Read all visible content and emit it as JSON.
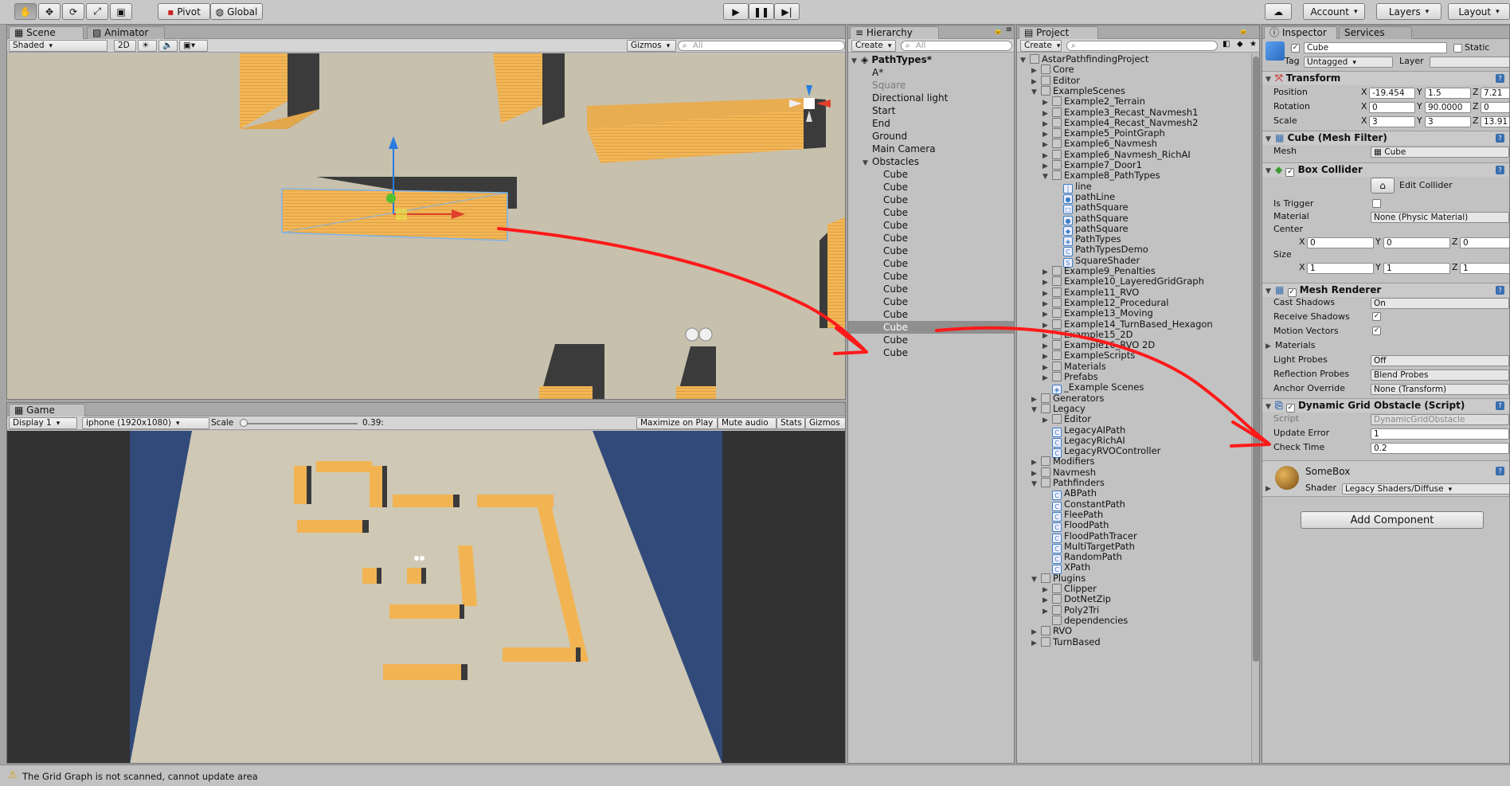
{
  "toolbar": {
    "tools": [
      "hand-icon",
      "move-icon",
      "rotate-icon",
      "scale-icon",
      "rect-icon"
    ],
    "pivot": "Pivot",
    "global": "Global",
    "account": "Account",
    "layers": "Layers",
    "layout": "Layout"
  },
  "scene": {
    "tab": "Scene",
    "tab2": "Animator",
    "shading": "Shaded",
    "mode2d": "2D",
    "gizmos": "Gizmos",
    "search": "All"
  },
  "game": {
    "tab": "Game",
    "display": "Display 1",
    "resolution": "iphone (1920x1080)",
    "scale_label": "Scale",
    "scale_value": "0.39:",
    "scale_fraction": 0.0,
    "maximize": "Maximize on Play",
    "mute": "Mute audio",
    "stats": "Stats",
    "gizmos": "Gizmos"
  },
  "hierarchy": {
    "tab": "Hierarchy",
    "create": "Create",
    "search": "All",
    "root": "PathTypes*",
    "items": [
      {
        "label": "A*",
        "depth": 1,
        "arrow": false
      },
      {
        "label": "Square",
        "depth": 1,
        "arrow": false,
        "dim": true
      },
      {
        "label": "Directional light",
        "depth": 1,
        "arrow": false
      },
      {
        "label": "Start",
        "depth": 1,
        "arrow": false
      },
      {
        "label": "End",
        "depth": 1,
        "arrow": false
      },
      {
        "label": "Ground",
        "depth": 1,
        "arrow": false
      },
      {
        "label": "Main Camera",
        "depth": 1,
        "arrow": false
      },
      {
        "label": "Obstacles",
        "depth": 1,
        "arrow": true
      },
      {
        "label": "Cube",
        "depth": 2
      },
      {
        "label": "Cube",
        "depth": 2
      },
      {
        "label": "Cube",
        "depth": 2
      },
      {
        "label": "Cube",
        "depth": 2
      },
      {
        "label": "Cube",
        "depth": 2
      },
      {
        "label": "Cube",
        "depth": 2
      },
      {
        "label": "Cube",
        "depth": 2
      },
      {
        "label": "Cube",
        "depth": 2
      },
      {
        "label": "Cube",
        "depth": 2
      },
      {
        "label": "Cube",
        "depth": 2
      },
      {
        "label": "Cube",
        "depth": 2
      },
      {
        "label": "Cube",
        "depth": 2
      },
      {
        "label": "Cube",
        "depth": 2,
        "selected": true
      },
      {
        "label": "Cube",
        "depth": 2
      },
      {
        "label": "Cube",
        "depth": 2
      }
    ]
  },
  "project": {
    "tab": "Project",
    "create": "Create",
    "items": [
      {
        "label": "AstarPathfindingProject",
        "depth": 0,
        "arrow": "open",
        "icon": "folder"
      },
      {
        "label": "Core",
        "depth": 1,
        "arrow": "closed",
        "icon": "folder"
      },
      {
        "label": "Editor",
        "depth": 1,
        "arrow": "closed",
        "icon": "folder"
      },
      {
        "label": "ExampleScenes",
        "depth": 1,
        "arrow": "open",
        "icon": "folder"
      },
      {
        "label": "Example2_Terrain",
        "depth": 2,
        "arrow": "closed",
        "icon": "folder"
      },
      {
        "label": "Example3_Recast_Navmesh1",
        "depth": 2,
        "arrow": "closed",
        "icon": "folder"
      },
      {
        "label": "Example4_Recast_Navmesh2",
        "depth": 2,
        "arrow": "closed",
        "icon": "folder"
      },
      {
        "label": "Example5_PointGraph",
        "depth": 2,
        "arrow": "closed",
        "icon": "folder"
      },
      {
        "label": "Example6_Navmesh",
        "depth": 2,
        "arrow": "closed",
        "icon": "folder"
      },
      {
        "label": "Example6_Navmesh_RichAI",
        "depth": 2,
        "arrow": "closed",
        "icon": "folder"
      },
      {
        "label": "Example7_Door1",
        "depth": 2,
        "arrow": "closed",
        "icon": "folder"
      },
      {
        "label": "Example8_PathTypes",
        "depth": 2,
        "arrow": "open",
        "icon": "folder"
      },
      {
        "label": "line",
        "depth": 3,
        "icon": "line"
      },
      {
        "label": "pathLine",
        "depth": 3,
        "icon": "material"
      },
      {
        "label": "pathSquare",
        "depth": 3,
        "icon": "texture"
      },
      {
        "label": "pathSquare",
        "depth": 3,
        "icon": "material"
      },
      {
        "label": "pathSquare",
        "depth": 3,
        "icon": "prefab"
      },
      {
        "label": "PathTypes",
        "depth": 3,
        "icon": "unity"
      },
      {
        "label": "PathTypesDemo",
        "depth": 3,
        "icon": "script"
      },
      {
        "label": "SquareShader",
        "depth": 3,
        "icon": "shader"
      },
      {
        "label": "Example9_Penalties",
        "depth": 2,
        "arrow": "closed",
        "icon": "folder"
      },
      {
        "label": "Example10_LayeredGridGraph",
        "depth": 2,
        "arrow": "closed",
        "icon": "folder"
      },
      {
        "label": "Example11_RVO",
        "depth": 2,
        "arrow": "closed",
        "icon": "folder"
      },
      {
        "label": "Example12_Procedural",
        "depth": 2,
        "arrow": "closed",
        "icon": "folder"
      },
      {
        "label": "Example13_Moving",
        "depth": 2,
        "arrow": "closed",
        "icon": "folder"
      },
      {
        "label": "Example14_TurnBased_Hexagon",
        "depth": 2,
        "arrow": "closed",
        "icon": "folder"
      },
      {
        "label": "Example15_2D",
        "depth": 2,
        "arrow": "closed",
        "icon": "folder"
      },
      {
        "label": "Example16_RVO 2D",
        "depth": 2,
        "arrow": "closed",
        "icon": "folder"
      },
      {
        "label": "ExampleScripts",
        "depth": 2,
        "arrow": "closed",
        "icon": "folder"
      },
      {
        "label": "Materials",
        "depth": 2,
        "arrow": "closed",
        "icon": "folder"
      },
      {
        "label": "Prefabs",
        "depth": 2,
        "arrow": "closed",
        "icon": "folder"
      },
      {
        "label": "_Example Scenes",
        "depth": 2,
        "icon": "unity"
      },
      {
        "label": "Generators",
        "depth": 1,
        "arrow": "closed",
        "icon": "folder"
      },
      {
        "label": "Legacy",
        "depth": 1,
        "arrow": "open",
        "icon": "folder"
      },
      {
        "label": "Editor",
        "depth": 2,
        "arrow": "closed",
        "icon": "folder"
      },
      {
        "label": "LegacyAIPath",
        "depth": 2,
        "icon": "script"
      },
      {
        "label": "LegacyRichAI",
        "depth": 2,
        "icon": "script"
      },
      {
        "label": "LegacyRVOController",
        "depth": 2,
        "icon": "script"
      },
      {
        "label": "Modifiers",
        "depth": 1,
        "arrow": "closed",
        "icon": "folder"
      },
      {
        "label": "Navmesh",
        "depth": 1,
        "arrow": "closed",
        "icon": "folder"
      },
      {
        "label": "Pathfinders",
        "depth": 1,
        "arrow": "open",
        "icon": "folder"
      },
      {
        "label": "ABPath",
        "depth": 2,
        "icon": "script"
      },
      {
        "label": "ConstantPath",
        "depth": 2,
        "icon": "script"
      },
      {
        "label": "FleePath",
        "depth": 2,
        "icon": "script"
      },
      {
        "label": "FloodPath",
        "depth": 2,
        "icon": "script"
      },
      {
        "label": "FloodPathTracer",
        "depth": 2,
        "icon": "script"
      },
      {
        "label": "MultiTargetPath",
        "depth": 2,
        "icon": "script"
      },
      {
        "label": "RandomPath",
        "depth": 2,
        "icon": "script"
      },
      {
        "label": "XPath",
        "depth": 2,
        "icon": "script"
      },
      {
        "label": "Plugins",
        "depth": 1,
        "arrow": "open",
        "icon": "folder"
      },
      {
        "label": "Clipper",
        "depth": 2,
        "arrow": "closed",
        "icon": "folder"
      },
      {
        "label": "DotNetZip",
        "depth": 2,
        "arrow": "closed",
        "icon": "folder"
      },
      {
        "label": "Poly2Tri",
        "depth": 2,
        "arrow": "closed",
        "icon": "folder"
      },
      {
        "label": "dependencies",
        "depth": 2,
        "icon": "folder"
      },
      {
        "label": "RVO",
        "depth": 1,
        "arrow": "closed",
        "icon": "folder"
      },
      {
        "label": "TurnBased",
        "depth": 1,
        "arrow": "closed",
        "icon": "folder"
      }
    ]
  },
  "inspector": {
    "tab": "Inspector",
    "tab2": "Services",
    "name": "Cube",
    "static": "Static",
    "tag_label": "Tag",
    "tag": "Untagged",
    "layer_label": "Layer",
    "transform": {
      "title": "Transform",
      "position_label": "Position",
      "position": [
        "-19.454",
        "1.5",
        "7.21"
      ],
      "rotation_label": "Rotation",
      "rotation": [
        "0",
        "90.0000",
        "0"
      ],
      "scale_label": "Scale",
      "scale": [
        "3",
        "3",
        "13.91"
      ]
    },
    "mesh_filter": {
      "title": "Cube (Mesh Filter)",
      "mesh_label": "Mesh",
      "mesh": "Cube"
    },
    "box_collider": {
      "title": "Box Collider",
      "edit": "Edit Collider",
      "trigger_label": "Is Trigger",
      "material_label": "Material",
      "material": "None (Physic Material)",
      "center_label": "Center",
      "center": [
        "0",
        "0",
        "0"
      ],
      "size_label": "Size",
      "size": [
        "1",
        "1",
        "1"
      ]
    },
    "mesh_renderer": {
      "title": "Mesh Renderer",
      "cast_label": "Cast Shadows",
      "cast": "On",
      "receive_label": "Receive Shadows",
      "motion_label": "Motion Vectors",
      "materials_label": "Materials",
      "light_label": "Light Probes",
      "light": "Off",
      "reflection_label": "Reflection Probes",
      "reflection": "Blend Probes",
      "anchor_label": "Anchor Override",
      "anchor": "None (Transform)"
    },
    "dynamic_obstacle": {
      "title": "Dynamic Grid Obstacle (Script)",
      "script_label": "Script",
      "script": "DynamicGridObstacle",
      "update_label": "Update Error",
      "update": "1",
      "check_label": "Check Time",
      "check": "0.2"
    },
    "material": {
      "name": "SomeBox",
      "shader_label": "Shader",
      "shader": "Legacy Shaders/Diffuse"
    },
    "add_component": "Add Component"
  },
  "status": {
    "message": "The Grid Graph is not scanned, cannot update area"
  },
  "colors": {
    "box": "#f2b453",
    "annotation": "#ff1a1a",
    "sky": "#314a7a",
    "selection": "#8f8f8f"
  }
}
